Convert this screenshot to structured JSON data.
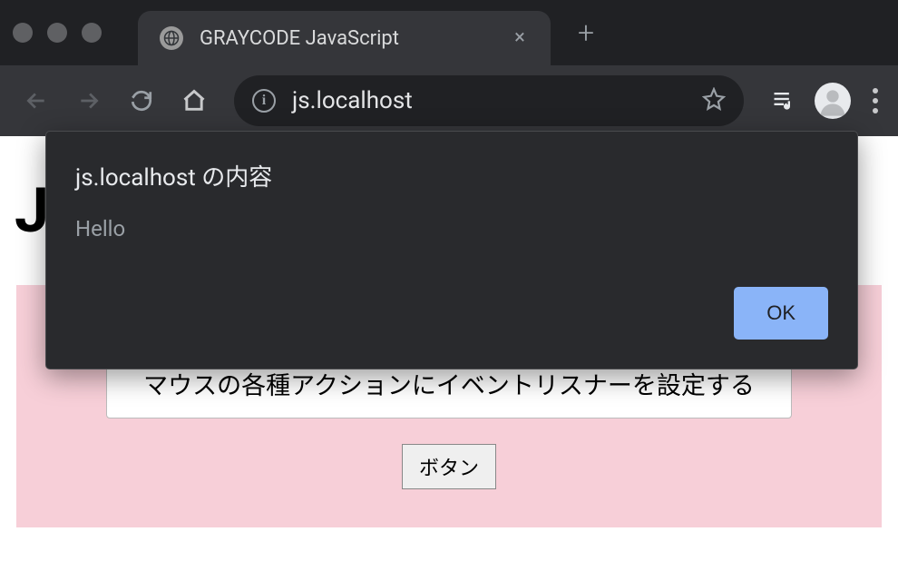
{
  "browser": {
    "tab_title": "GRAYCODE JavaScript",
    "url": "js.localhost",
    "new_tab_symbol": "+",
    "close_symbol": "×",
    "info_symbol": "i"
  },
  "alert": {
    "title": "js.localhost の内容",
    "message": "Hello",
    "ok_label": "OK"
  },
  "page": {
    "heading": "J",
    "box_text": "マウスの各種アクションにイベントリスナーを設定する",
    "button_label": "ボタン"
  }
}
